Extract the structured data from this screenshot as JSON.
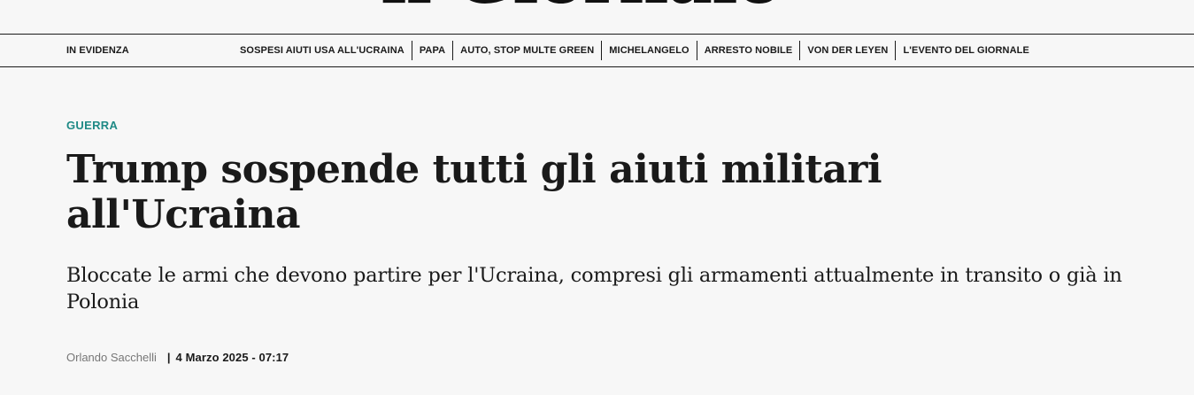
{
  "masthead": {
    "logo_text": "il Giornale"
  },
  "nav": {
    "label": "IN EVIDENZA",
    "links": [
      "SOSPESI AIUTI USA ALL'UCRAINA",
      "PAPA",
      "AUTO, STOP MULTE GREEN",
      "MICHELANGELO",
      "ARRESTO NOBILE",
      "VON DER LEYEN",
      "L'EVENTO DEL GIORNALE"
    ]
  },
  "article": {
    "category": "GUERRA",
    "headline": "Trump sospende tutti gli aiuti militari all'Ucraina",
    "subheadline": "Bloccate le armi che devono partire per l'Ucraina, compresi gli armamenti attualmente in transito o già in Polonia",
    "author": "Orlando Sacchelli",
    "separator": "|",
    "date": "4 Marzo 2025 - 07:17"
  },
  "colors": {
    "background": "#f7f7f7",
    "category_accent": "#1f8a86",
    "text": "#1a1a1a",
    "author_text": "#777777"
  }
}
